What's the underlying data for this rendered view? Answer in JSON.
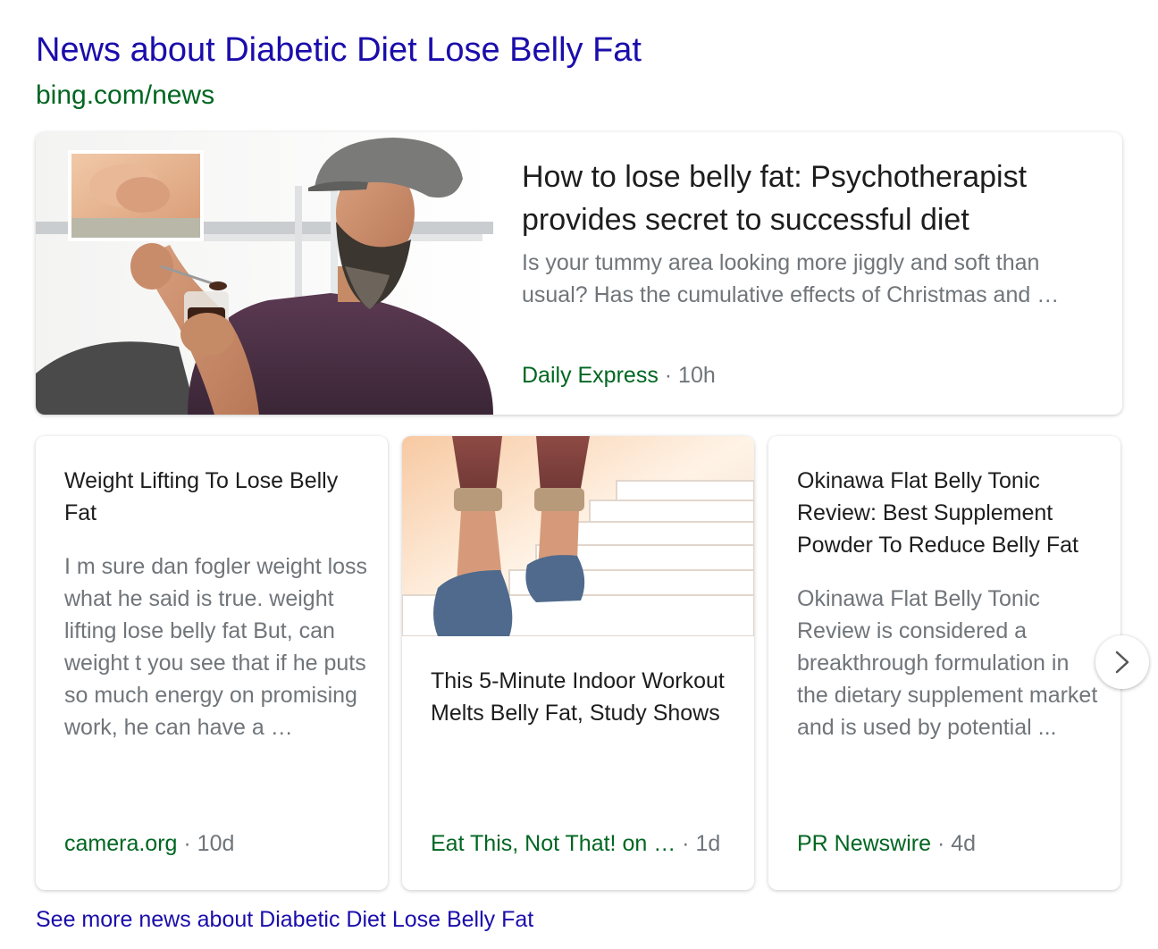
{
  "header": {
    "title": "News about Diabetic Diet Lose Belly Fat",
    "source_url": "bing.com/news"
  },
  "featured": {
    "image_icon": "man-eating-dessert-photo",
    "title": "How to lose belly fat: Psychotherapist provides secret to successful diet",
    "snippet": "Is your tummy area looking more jiggly and soft than usual? Has the cumulative effects of Christmas and …",
    "source": "Daily Express",
    "separator": " · ",
    "age": "10h"
  },
  "cards": [
    {
      "title": "Weight Lifting To Lose Belly Fat",
      "snippet": "I m sure dan fogler weight loss what he said is true. weight lifting lose belly fat But, can weight t you see that if he puts so much energy on promising work, he can have a …",
      "source": "camera.org",
      "separator": " · ",
      "age": "10d"
    },
    {
      "image_icon": "person-walking-stairs-photo",
      "title": "This 5-Minute Indoor Workout Melts Belly Fat, Study Shows",
      "source": "Eat This, Not That! on …",
      "separator": " · ",
      "age": "1d"
    },
    {
      "title": "Okinawa Flat Belly Tonic Review: Best Supplement Powder To Reduce Belly Fat",
      "snippet": "Okinawa Flat Belly Tonic Review is considered a breakthrough formulation in the dietary supplement market and is used by potential ...",
      "source": "PR Newswire",
      "separator": " · ",
      "age": "4d"
    }
  ],
  "next_button": {
    "icon": "chevron-right-icon"
  },
  "footer": {
    "see_more": "See more news about Diabetic Diet Lose Belly Fat"
  },
  "colors": {
    "link": "#1a0dab",
    "source_green": "#006621",
    "snippet_gray": "#70757a",
    "title_text": "#1d1d1d"
  }
}
